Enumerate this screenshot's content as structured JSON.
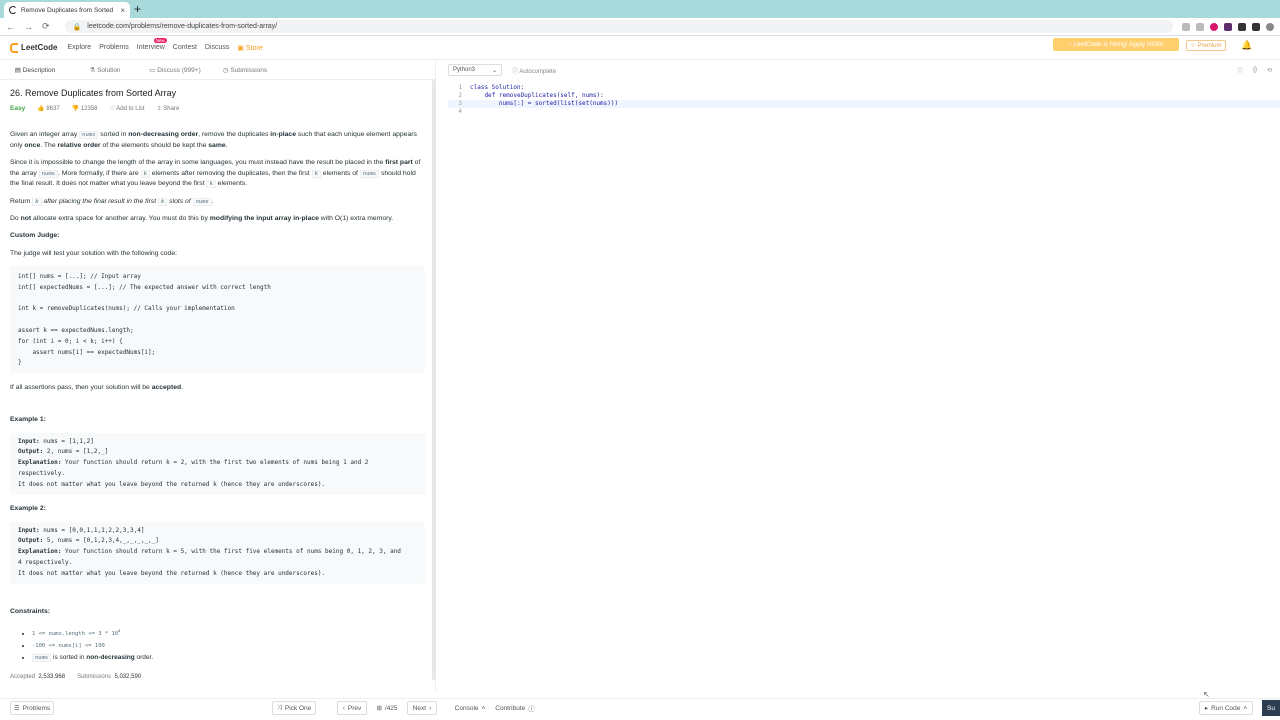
{
  "browser": {
    "tab_title": "Remove Duplicates from Sorted",
    "url": "leetcode.com/problems/remove-duplicates-from-sorted-array/"
  },
  "nav": {
    "logo": "LeetCode",
    "links": [
      "Explore",
      "Problems",
      "Interview",
      "Contest",
      "Discuss",
      "Store"
    ],
    "new_badge": "New",
    "hiring": "LeetCode is hiring! Apply NOW.",
    "premium": "Premium"
  },
  "left_tabs": [
    "Description",
    "Solution",
    "Discuss (999+)",
    "Submissions"
  ],
  "problem": {
    "title": "26. Remove Duplicates from Sorted Array",
    "difficulty": "Easy",
    "likes": "8637",
    "dislikes": "12358",
    "add_to_list": "Add to List",
    "share": "Share",
    "p1": [
      "Given an integer array ",
      "nums",
      " sorted in ",
      "non-decreasing order",
      ", remove the duplicates ",
      "in-place",
      " such that each unique element appears only ",
      "once",
      ". The ",
      "relative order",
      " of the elements should be kept the ",
      "same",
      "."
    ],
    "p2": [
      "Since it is impossible to change the length of the array in some languages, you must instead have the result be placed in the ",
      "first part",
      " of the array ",
      "nums",
      ". More formally, if there are ",
      "k",
      " elements after removing the duplicates, then the first ",
      "k",
      " elements of ",
      "nums",
      " should hold the final result. It does not matter what you leave beyond the first ",
      "k",
      " elements."
    ],
    "p3": [
      "Return ",
      "k",
      " after placing the final result in the first ",
      "k",
      " slots of ",
      "nums",
      "."
    ],
    "p4": [
      "Do ",
      "not",
      " allocate extra space for another array. You must do this by ",
      "modifying the input array ",
      "in-place",
      " with O(1) extra memory."
    ],
    "custom_judge_heading": "Custom Judge:",
    "custom_judge_text": "The judge will test your solution with the following code:",
    "judge_code": "int[] nums = [...]; // Input array\nint[] expectedNums = [...]; // The expected answer with correct length\n\nint k = removeDuplicates(nums); // Calls your implementation\n\nassert k == expectedNums.length;\nfor (int i = 0; i < k; i++) {\n    assert nums[i] == expectedNums[i];\n}",
    "accepted_line": [
      "If all assertions pass, then your solution will be ",
      "accepted",
      "."
    ],
    "example1_heading": "Example 1:",
    "example1": {
      "input_label": "Input:",
      "input": " nums = [1,1,2]",
      "output_label": "Output:",
      "output": " 2, nums = [1,2,_]",
      "expl_label": "Explanation:",
      "expl": " Your function should return k = 2, with the first two elements of nums being 1 and 2\nrespectively.\nIt does not matter what you leave beyond the returned k (hence they are underscores)."
    },
    "example2_heading": "Example 2:",
    "example2": {
      "input_label": "Input:",
      "input": " nums = [0,0,1,1,1,2,2,3,3,4]",
      "output_label": "Output:",
      "output": " 5, nums = [0,1,2,3,4,_,_,_,_,_]",
      "expl_label": "Explanation:",
      "expl": " Your function should return k = 5, with the first five elements of nums being 0, 1, 2, 3, and\n4 respectively.\nIt does not matter what you leave beyond the returned k (hence they are underscores)."
    },
    "constraints_heading": "Constraints:",
    "constraints": [
      "1 <= nums.length <= 3 * 10",
      "-100 <= nums[i] <= 100"
    ],
    "constraint1_exp": "4",
    "constraint3": [
      "nums",
      " is sorted in ",
      "non-decreasing",
      " order."
    ],
    "accepted_label": "Accepted",
    "accepted_value": "2,533,968",
    "submissions_label": "Submissions",
    "submissions_value": "5,032,590"
  },
  "editor": {
    "language": "Python3",
    "autocomplete": "Autocomplete",
    "lines": [
      {
        "n": "1",
        "code": "class Solution:"
      },
      {
        "n": "2",
        "code": "    def removeDuplicates(self, nums):"
      },
      {
        "n": "3",
        "code": "        nums[:] = sorted(list(set(nums)))"
      },
      {
        "n": "4",
        "code": ""
      }
    ]
  },
  "footer": {
    "problems": "Problems",
    "pick_one": "Pick One",
    "prev": "Prev",
    "page": "/425",
    "next": "Next",
    "console": "Console",
    "contribute": "Contribute",
    "run_code": "Run Code",
    "submit": "Su"
  }
}
